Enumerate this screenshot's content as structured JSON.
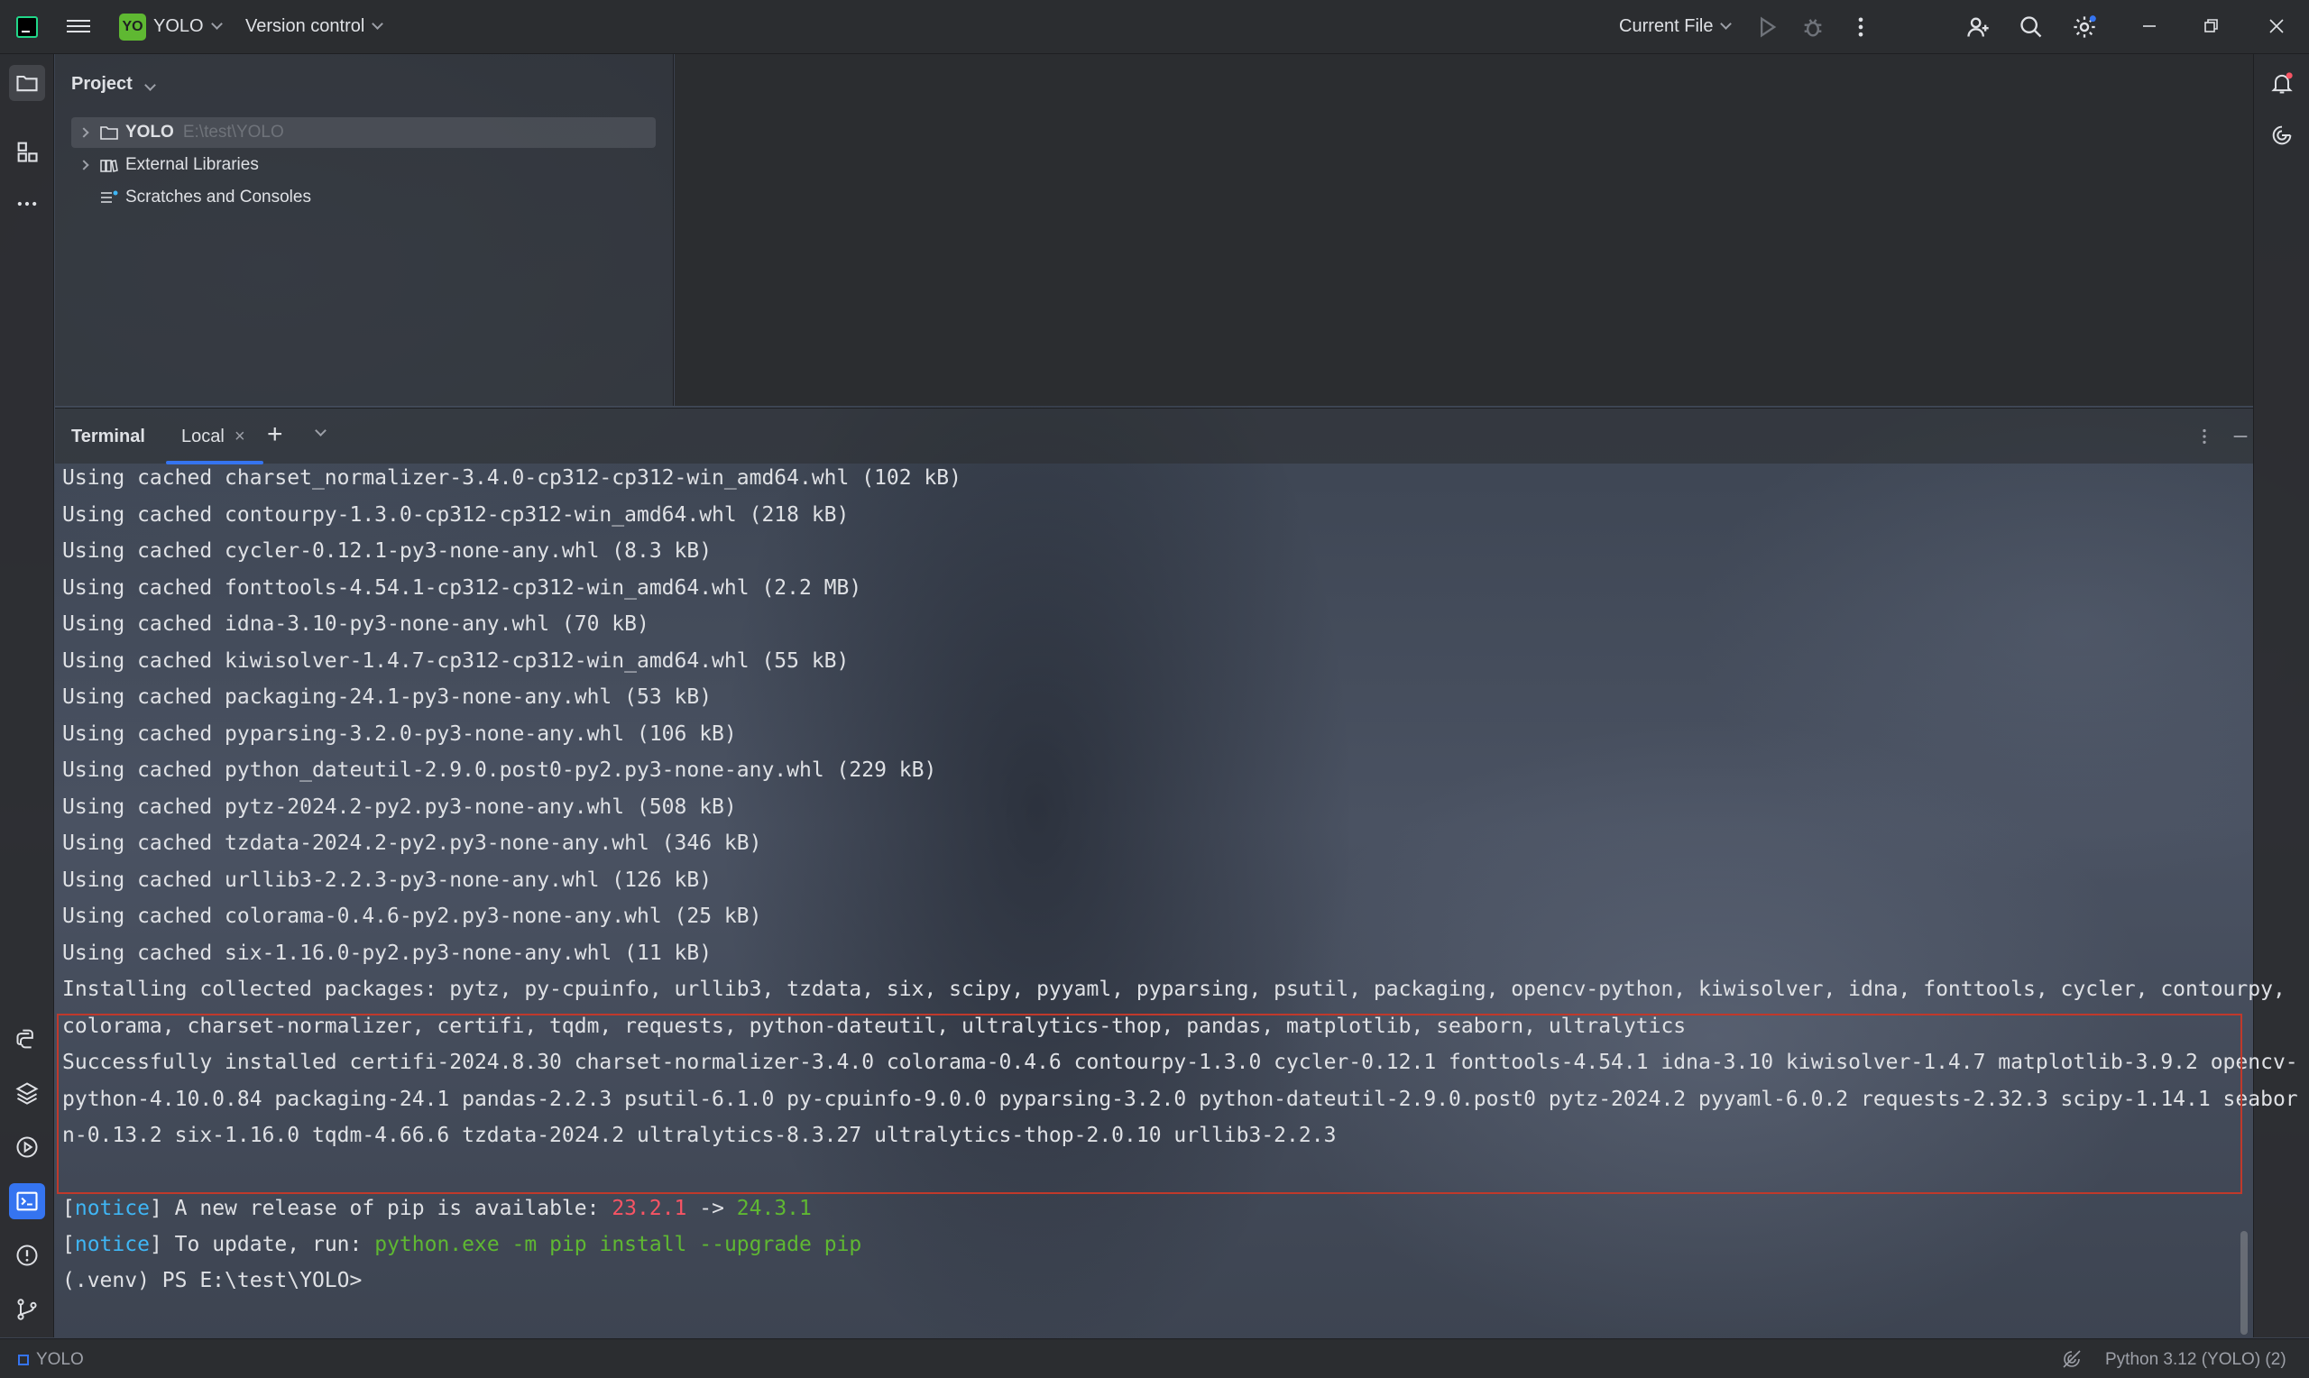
{
  "titlebar": {
    "project_badge": "YO",
    "project_name": "YOLO",
    "version_control": "Version control",
    "current_file": "Current File"
  },
  "project_panel": {
    "title": "Project",
    "tree": [
      {
        "label": "YOLO",
        "path": "E:\\test\\YOLO"
      },
      {
        "label": "External Libraries"
      },
      {
        "label": "Scratches and Consoles"
      }
    ]
  },
  "terminal": {
    "title": "Terminal",
    "tab": "Local",
    "lines": [
      "Using cached charset_normalizer-3.4.0-cp312-cp312-win_amd64.whl (102 kB)",
      "Using cached contourpy-1.3.0-cp312-cp312-win_amd64.whl (218 kB)",
      "Using cached cycler-0.12.1-py3-none-any.whl (8.3 kB)",
      "Using cached fonttools-4.54.1-cp312-cp312-win_amd64.whl (2.2 MB)",
      "Using cached idna-3.10-py3-none-any.whl (70 kB)",
      "Using cached kiwisolver-1.4.7-cp312-cp312-win_amd64.whl (55 kB)",
      "Using cached packaging-24.1-py3-none-any.whl (53 kB)",
      "Using cached pyparsing-3.2.0-py3-none-any.whl (106 kB)",
      "Using cached python_dateutil-2.9.0.post0-py2.py3-none-any.whl (229 kB)",
      "Using cached pytz-2024.2-py2.py3-none-any.whl (508 kB)",
      "Using cached tzdata-2024.2-py2.py3-none-any.whl (346 kB)",
      "Using cached urllib3-2.2.3-py3-none-any.whl (126 kB)",
      "Using cached colorama-0.4.6-py2.py3-none-any.whl (25 kB)",
      "Using cached six-1.16.0-py2.py3-none-any.whl (11 kB)",
      "Installing collected packages: pytz, py-cpuinfo, urllib3, tzdata, six, scipy, pyyaml, pyparsing, psutil, packaging, opencv-python, kiwisolver, idna, fonttools, cycler, contourpy,",
      "colorama, charset-normalizer, certifi, tqdm, requests, python-dateutil, ultralytics-thop, pandas, matplotlib, seaborn, ultralytics",
      "Successfully installed certifi-2024.8.30 charset-normalizer-3.4.0 colorama-0.4.6 contourpy-1.3.0 cycler-0.12.1 fonttools-4.54.1 idna-3.10 kiwisolver-1.4.7 matplotlib-3.9.2 opencv-",
      "python-4.10.0.84 packaging-24.1 pandas-2.2.3 psutil-6.1.0 py-cpuinfo-9.0.0 pyparsing-3.2.0 python-dateutil-2.9.0.post0 pytz-2024.2 pyyaml-6.0.2 requests-2.32.3 scipy-1.14.1 seabor",
      "n-0.13.2 six-1.16.0 tqdm-4.66.6 tzdata-2024.2 ultralytics-8.3.27 ultralytics-thop-2.0.10 urllib3-2.2.3"
    ],
    "notice1": {
      "tag": "notice",
      "text": " A new release of pip is available: ",
      "old": "23.2.1",
      "arrow": " -> ",
      "new": "24.3.1"
    },
    "notice2": {
      "tag": "notice",
      "text": " To update, run: ",
      "cmd": "python.exe -m pip install --upgrade pip"
    },
    "prompt": "(.venv) PS E:\\test\\YOLO>"
  },
  "statusbar": {
    "project": "YOLO",
    "interpreter": "Python 3.12 (YOLO) (2)"
  },
  "colors": {
    "accent": "#3574f0",
    "notice": "#3fb6f5",
    "old_version": "#f75464",
    "new_version": "#5fb832",
    "highlight_border": "#c0392b"
  }
}
